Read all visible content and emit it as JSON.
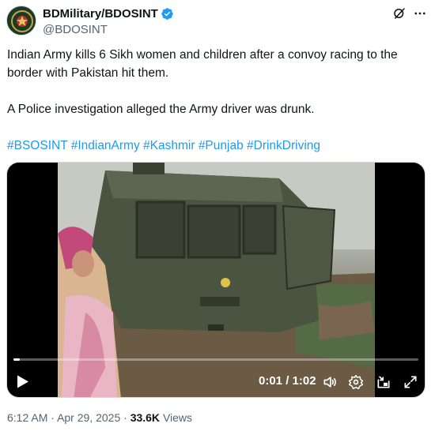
{
  "author": {
    "display_name": "BDMilitary/BDOSINT",
    "handle": "@BDOSINT",
    "verified": true,
    "avatar_icon": "military-emblem-avatar"
  },
  "actions": {
    "grok_icon": "grok-icon",
    "more_icon": "more-options-icon"
  },
  "tweet": {
    "paragraph1": "Indian Army kills 6 Sikh women and children after a convoy racing to the border with Pakistan hit them.",
    "paragraph2": "A Police investigation alleged the Army driver was drunk.",
    "hashtags": [
      "#BSOSINT",
      "#IndianArmy",
      "#Kashmir",
      "#Punjab",
      "#DrinkDriving"
    ]
  },
  "video": {
    "current_time": "0:01",
    "duration": "1:02",
    "time_display": "0:01 / 1:02",
    "progress_fraction": 0.016,
    "controls": [
      "play-icon",
      "volume-icon",
      "settings-icon",
      "pip-icon",
      "fullscreen-icon"
    ]
  },
  "meta": {
    "time": "6:12 AM",
    "separator": "·",
    "date": "Apr 29, 2025",
    "views_count": "33.6K",
    "views_label": "Views"
  },
  "colors": {
    "link": "#1d9bf0",
    "text": "#0f1419",
    "secondary": "#536471",
    "verified": "#1d9bf0"
  }
}
